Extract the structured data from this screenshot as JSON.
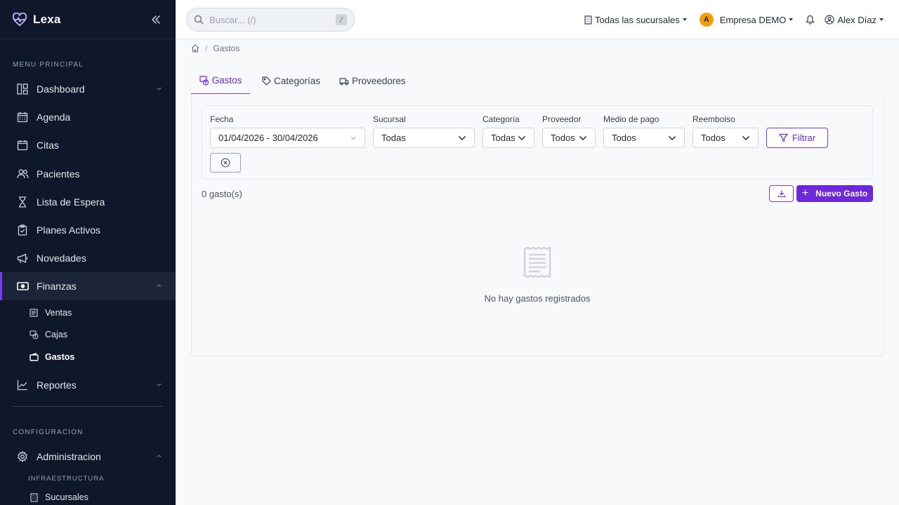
{
  "app": {
    "name": "Lexa"
  },
  "sidebar": {
    "main_section": "MENU PRINCIPAL",
    "items": [
      {
        "label": "Dashboard",
        "icon": "dashboard-icon"
      },
      {
        "label": "Agenda",
        "icon": "calendar-grid-icon"
      },
      {
        "label": "Citas",
        "icon": "calendar-icon"
      },
      {
        "label": "Pacientes",
        "icon": "users-icon"
      },
      {
        "label": "Lista de Espera",
        "icon": "hourglass-icon"
      },
      {
        "label": "Planes Activos",
        "icon": "clipboard-check-icon"
      },
      {
        "label": "Novedades",
        "icon": "megaphone-icon"
      },
      {
        "label": "Finanzas",
        "icon": "cash-icon"
      },
      {
        "label": "Reportes",
        "icon": "chart-line-icon"
      }
    ],
    "finanzas_sub": [
      {
        "label": "Ventas",
        "icon": "receipt-icon"
      },
      {
        "label": "Cajas",
        "icon": "cash-register-icon"
      },
      {
        "label": "Gastos",
        "icon": "wallet-icon"
      }
    ],
    "config_section": "CONFIGURACION",
    "admin": {
      "label": "Administracion",
      "icon": "gear-icon"
    },
    "infra_section": "INFRAESTRUCTURA",
    "infra_sub": [
      {
        "label": "Sucursales",
        "icon": "building-icon"
      }
    ]
  },
  "topbar": {
    "search_placeholder": "Buscar... (/)",
    "search_shortcut": "/",
    "branch": "Todas las sucursales",
    "company_initial": "A",
    "company": "Empresa DEMO",
    "user": "Alex Díaz"
  },
  "breadcrumb": {
    "current": "Gastos"
  },
  "tabs": [
    {
      "label": "Gastos",
      "icon": "receipt-cash-icon"
    },
    {
      "label": "Categorías",
      "icon": "tag-icon"
    },
    {
      "label": "Proveedores",
      "icon": "truck-icon"
    }
  ],
  "filters": {
    "fecha": {
      "label": "Fecha",
      "value": "01/04/2026 - 30/04/2026"
    },
    "sucursal": {
      "label": "Sucursal",
      "value": "Todas"
    },
    "categoria": {
      "label": "Categoría",
      "value": "Todas"
    },
    "proveedor": {
      "label": "Proveedor",
      "value": "Todos"
    },
    "medio_pago": {
      "label": "Medio de pago",
      "value": "Todos"
    },
    "reembolso": {
      "label": "Reembolso",
      "value": "Todos"
    },
    "filtrar_label": "Filtrar"
  },
  "list": {
    "count": "0 gasto(s)",
    "new_label": "Nuevo Gasto",
    "empty_text": "No hay gastos registrados"
  },
  "colors": {
    "accent": "#6d28d9",
    "sidebar_bg": "#0f172a",
    "company_badge": "#f59e0b"
  }
}
